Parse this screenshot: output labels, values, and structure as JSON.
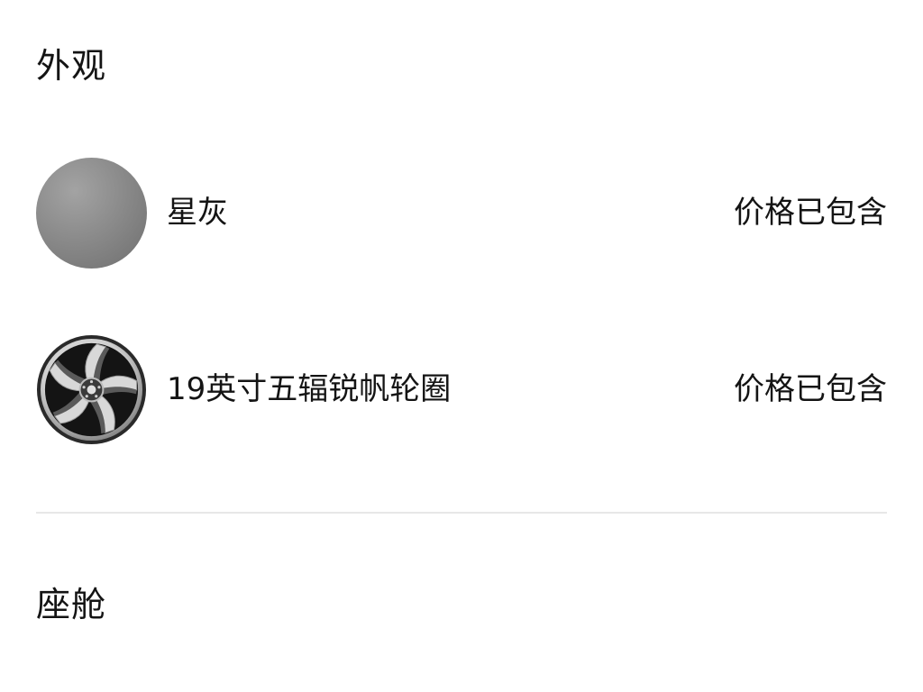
{
  "exterior": {
    "title": "外观",
    "options": [
      {
        "icon": "color-swatch-icon",
        "color": "#8b8b8b",
        "name": "星灰",
        "price": "价格已包含"
      },
      {
        "icon": "wheel-rim-icon",
        "name": "19英寸五辐锐帆轮圈",
        "price": "价格已包含"
      }
    ]
  },
  "cabin": {
    "title": "座舱"
  }
}
